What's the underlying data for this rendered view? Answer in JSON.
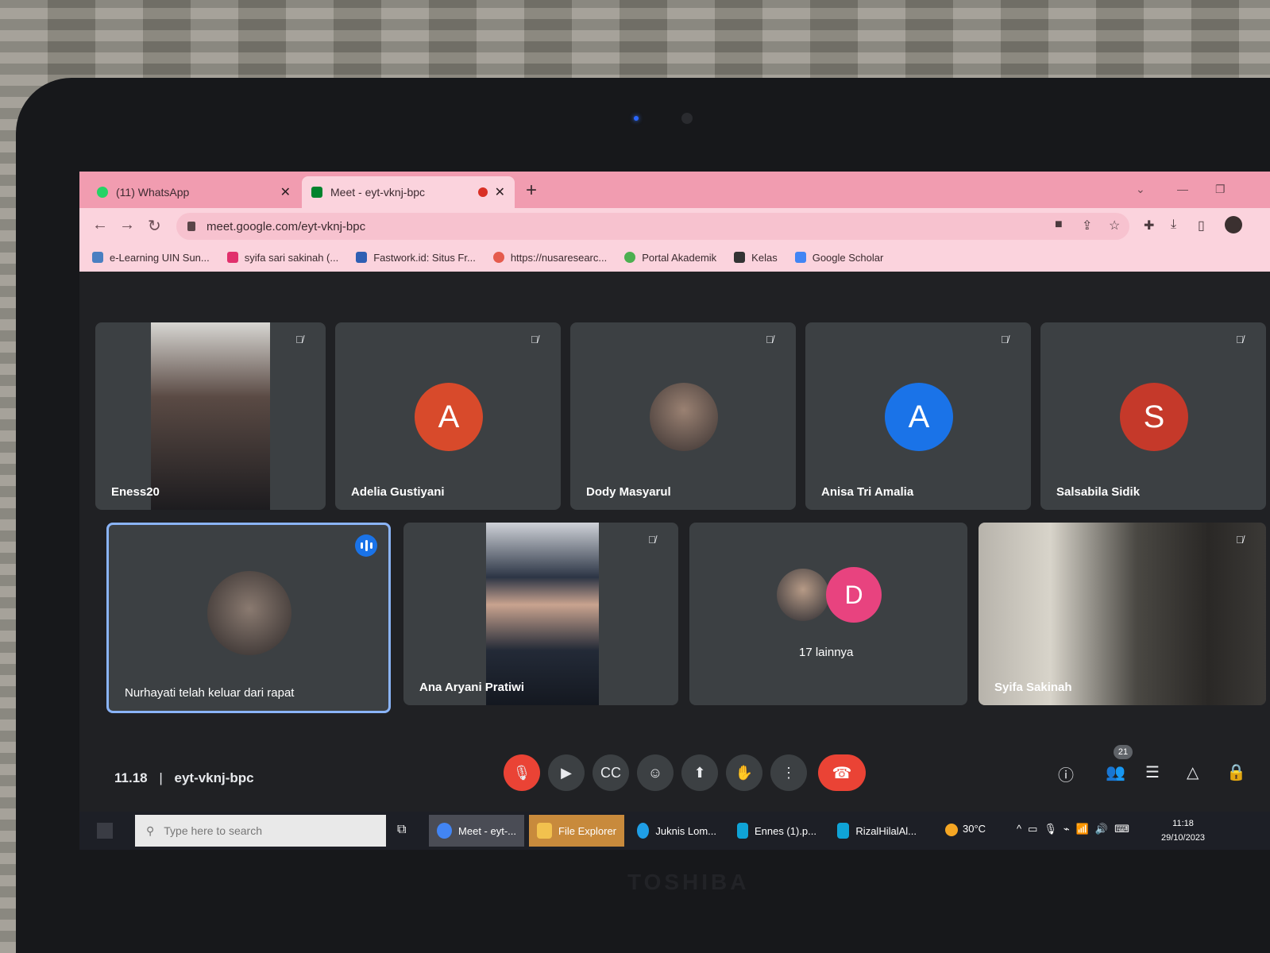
{
  "browser": {
    "tabs": [
      {
        "label": "(11) WhatsApp",
        "color": "#25d366"
      },
      {
        "label": "Meet - eyt-vknj-bpc",
        "color": "#00832d"
      }
    ],
    "url": "meet.google.com/eyt-vknj-bpc",
    "bookmarks": [
      {
        "label": "e-Learning UIN Sun...",
        "color": "#4a7fc1"
      },
      {
        "label": "syifa sari sakinah (...",
        "color": "#e1306c"
      },
      {
        "label": "Fastwork.id: Situs Fr...",
        "color": "#2f5fb3"
      },
      {
        "label": "https://nusaresearc...",
        "color": "#e55b4d"
      },
      {
        "label": "Portal Akademik",
        "color": "#4caf50"
      },
      {
        "label": "Kelas",
        "color": "#333333"
      },
      {
        "label": "Google Scholar",
        "color": "#4285f4"
      }
    ]
  },
  "meet": {
    "tiles": [
      {
        "name": "Eness20"
      },
      {
        "name": "Adelia Gustiyani",
        "initial": "A",
        "color": "#d84a2b"
      },
      {
        "name": "Dody Masyarul"
      },
      {
        "name": "Anisa Tri Amalia",
        "initial": "A",
        "color": "#1a73e8"
      },
      {
        "name": "Salsabila Sidik",
        "initial": "S",
        "color": "#c5392a"
      },
      {
        "name": "Nurhayati telah keluar dari rapat"
      },
      {
        "name": "Ana Aryani Pratiwi"
      },
      {
        "name": "17 lainnya",
        "initial": "D",
        "color": "#e8437f"
      },
      {
        "name": "Syifa Sakinah"
      }
    ],
    "time": "11.18",
    "code": "eyt-vknj-bpc",
    "participant_count": "21"
  },
  "taskbar": {
    "search_placeholder": "Type here to search",
    "apps": [
      "Meet - eyt-...",
      "File Explorer",
      "Juknis Lom...",
      "Ennes (1).p...",
      "RizalHilalAl..."
    ],
    "temperature": "30°C",
    "time": "11:18",
    "date": "29/10/2023"
  },
  "device": {
    "brand": "TOSHIBA"
  }
}
